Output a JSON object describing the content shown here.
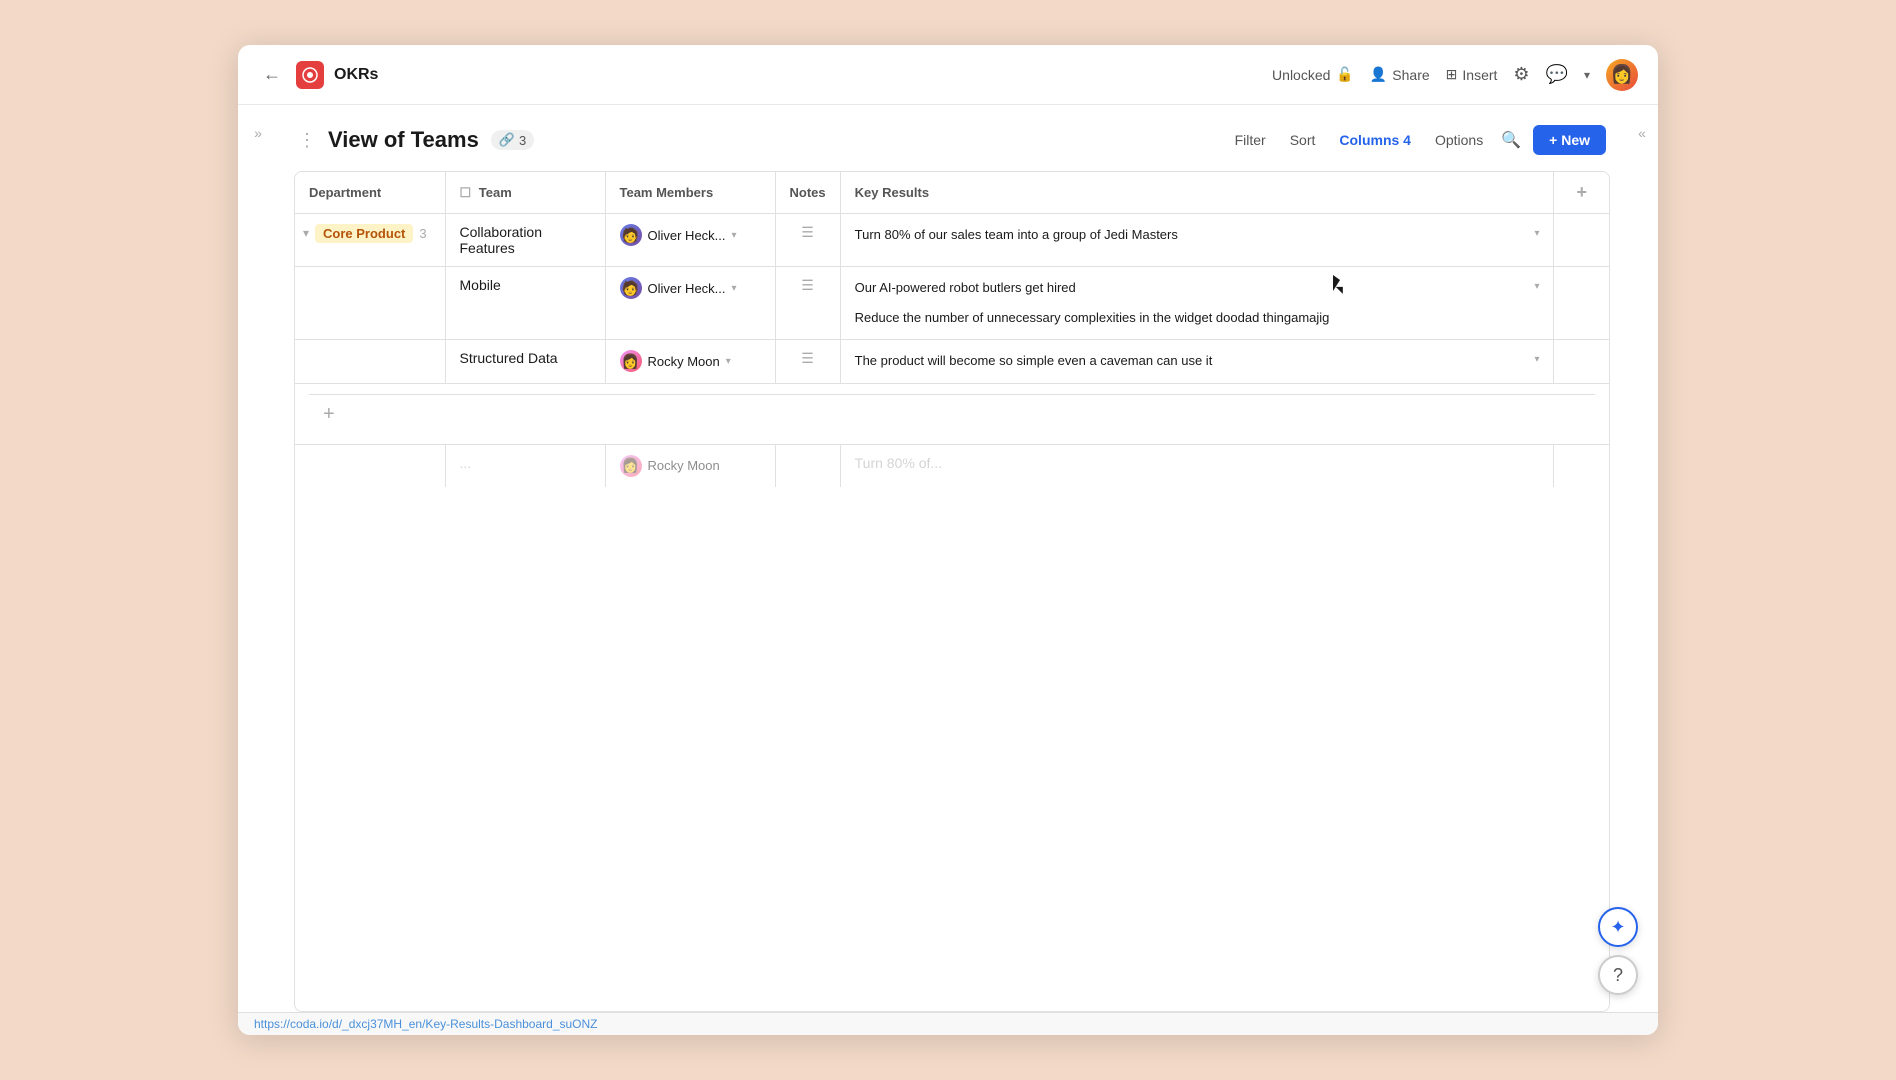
{
  "app": {
    "title": "OKRs",
    "icon_label": "O"
  },
  "header": {
    "back_label": "←",
    "unlocked_label": "Unlocked",
    "share_label": "Share",
    "insert_label": "Insert"
  },
  "view": {
    "title": "View of Teams",
    "link_count": "3",
    "filter_label": "Filter",
    "sort_label": "Sort",
    "columns_label": "Columns 4",
    "options_label": "Options",
    "new_label": "+ New"
  },
  "table": {
    "columns": [
      "Department",
      "Team",
      "Team Members",
      "Notes",
      "Key Results"
    ],
    "rows": [
      {
        "dept": "Core Product",
        "dept_count": "3",
        "team": "Collaboration Features",
        "member_name": "Oliver Heck...",
        "member_type": "oliver",
        "key_results": [
          "Turn 80% of our sales team into a group of Jedi Masters"
        ]
      },
      {
        "dept": "",
        "dept_count": "",
        "team": "Mobile",
        "member_name": "Oliver Heck...",
        "member_type": "oliver",
        "key_results": [
          "Our AI-powered robot butlers get hired",
          "Reduce the number of unnecessary complexities in the widget doodad thingamajig"
        ]
      },
      {
        "dept": "",
        "dept_count": "",
        "team": "Structured Data",
        "member_name": "Rocky Moon",
        "member_type": "rocky",
        "key_results": [
          "The product will become so simple even a caveman can use it"
        ]
      }
    ]
  },
  "status_bar": {
    "url": "https://coda.io/d/_dxcj37MH_en/Key-Results-Dashboard_suONZ"
  },
  "fab": {
    "sparkle_label": "✦",
    "help_label": "?"
  }
}
